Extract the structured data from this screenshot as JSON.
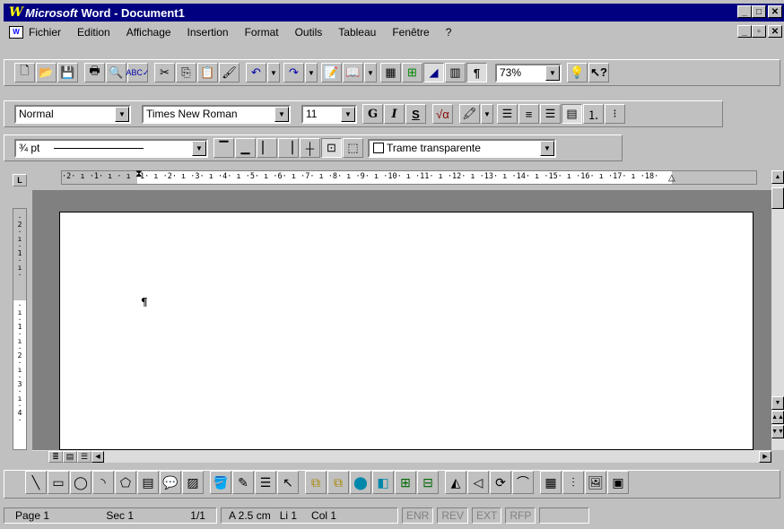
{
  "title": {
    "brand": "Microsoft",
    "text": "Word - Document1"
  },
  "titlebar_buttons": [
    "_",
    "□",
    "✕"
  ],
  "menu": [
    "Fichier",
    "Edition",
    "Affichage",
    "Insertion",
    "Format",
    "Outils",
    "Tableau",
    "Fenêtre",
    "?"
  ],
  "standard_toolbar": {
    "zoom": "73%"
  },
  "formatting_toolbar": {
    "style": "Normal",
    "font": "Times New Roman",
    "size": "11",
    "bold": "G",
    "italic": "I",
    "underline": "S"
  },
  "borders_toolbar": {
    "line_width": "¾ pt",
    "shading": "Trame transparente"
  },
  "ruler": {
    "horizontal": "·2· ı ·1· ı · ı ·1· ı ·2· ı ·3· ı ·4· ı ·5· ı ·6· ı ·7· ı ·8· ı ·9· ı ·10· ı ·11· ı ·12· ı ·13· ı ·14· ı ·15· ı ·16· ı ·17· ı ·18·",
    "vertical_top": "· 2 · ı · 1 · ı ·",
    "vertical_bottom": "· ı · 1 · ı · 2 · ı · 3 · ı · 4 ·"
  },
  "status": {
    "page": "Page 1",
    "section": "Sec 1",
    "pages": "1/1",
    "position": "A 2.5 cm",
    "line": "Li 1",
    "column": "Col 1",
    "modes": [
      "ENR",
      "REV",
      "EXT",
      "RFP"
    ]
  }
}
